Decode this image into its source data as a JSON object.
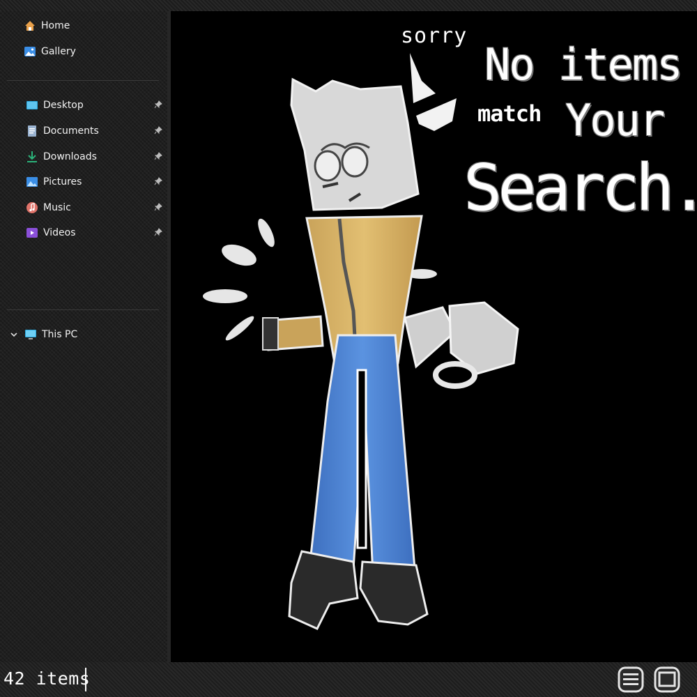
{
  "sidebar": {
    "quick": [
      {
        "label": "Home",
        "icon": "home-icon"
      },
      {
        "label": "Gallery",
        "icon": "gallery-icon"
      }
    ],
    "pinned": [
      {
        "label": "Desktop",
        "icon": "desktop-icon"
      },
      {
        "label": "Documents",
        "icon": "documents-icon"
      },
      {
        "label": "Downloads",
        "icon": "downloads-icon"
      },
      {
        "label": "Pictures",
        "icon": "pictures-icon"
      },
      {
        "label": "Music",
        "icon": "music-icon"
      },
      {
        "label": "Videos",
        "icon": "videos-icon"
      }
    ],
    "this_pc": {
      "label": "This PC",
      "icon": "this-pc-icon",
      "expanded": false
    }
  },
  "empty_message": {
    "sorry": "sorry",
    "line1": "No items",
    "match": "match",
    "your": "Your",
    "search": "Search."
  },
  "status": {
    "item_count": "42 items"
  },
  "colors": {
    "accent_blue": "#4a86d4",
    "jacket_tan": "#d9b56b",
    "background": "#000000"
  }
}
